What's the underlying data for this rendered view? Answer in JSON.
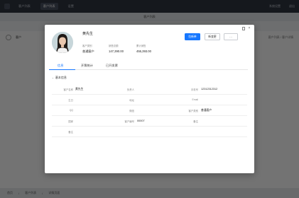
{
  "app": {
    "nav": [
      "客户列表",
      "客户列表",
      "设置"
    ],
    "right_links": [
      "系统设置",
      "退出"
    ],
    "subheader_title": "客户列表",
    "bg_row_label": "客户",
    "bg_row_right": "客户列表 / 客户详情",
    "footer": [
      "首页",
      "/",
      "客户列表",
      "/",
      "详情页面"
    ]
  },
  "modal": {
    "customer_name": "黄先生",
    "fields": {
      "customer_type_label": "客户类别",
      "customer_type_value": "普通客户",
      "sales_amount_label": "销售总额",
      "sales_amount_value": "147,390.00",
      "total_sales_label": "累计销售",
      "total_sales_value": "455,393.00"
    },
    "buttons": {
      "primary": "拉新单",
      "secondary": "新变更",
      "more": "···"
    },
    "tabs": [
      "信息",
      "开票统计",
      "已开发票"
    ],
    "section_title": "基本信息",
    "grid": [
      [
        {
          "label": "客户名称",
          "value": "黄先生"
        },
        {
          "label": "负责人",
          "value": ""
        },
        {
          "label": "手机号",
          "value": "12312312312"
        }
      ],
      [
        {
          "label": "生日",
          "value": ""
        },
        {
          "label": "地址",
          "value": ""
        },
        {
          "label": "Email",
          "value": ""
        }
      ],
      [
        {
          "label": "QQ",
          "value": ""
        },
        {
          "label": "微信",
          "value": ""
        },
        {
          "label": "客户类别",
          "value": "普通客户"
        }
      ],
      [
        {
          "label": "国家",
          "value": ""
        },
        {
          "label": "客户编号",
          "value": "00007"
        },
        {
          "label": "备注",
          "value": ""
        }
      ],
      [
        {
          "label": "备注",
          "value": ""
        },
        {
          "label": "",
          "value": ""
        },
        {
          "label": "",
          "value": ""
        }
      ]
    ]
  },
  "colors": {
    "accent": "#1677ff",
    "topbar": "#2f3542"
  }
}
